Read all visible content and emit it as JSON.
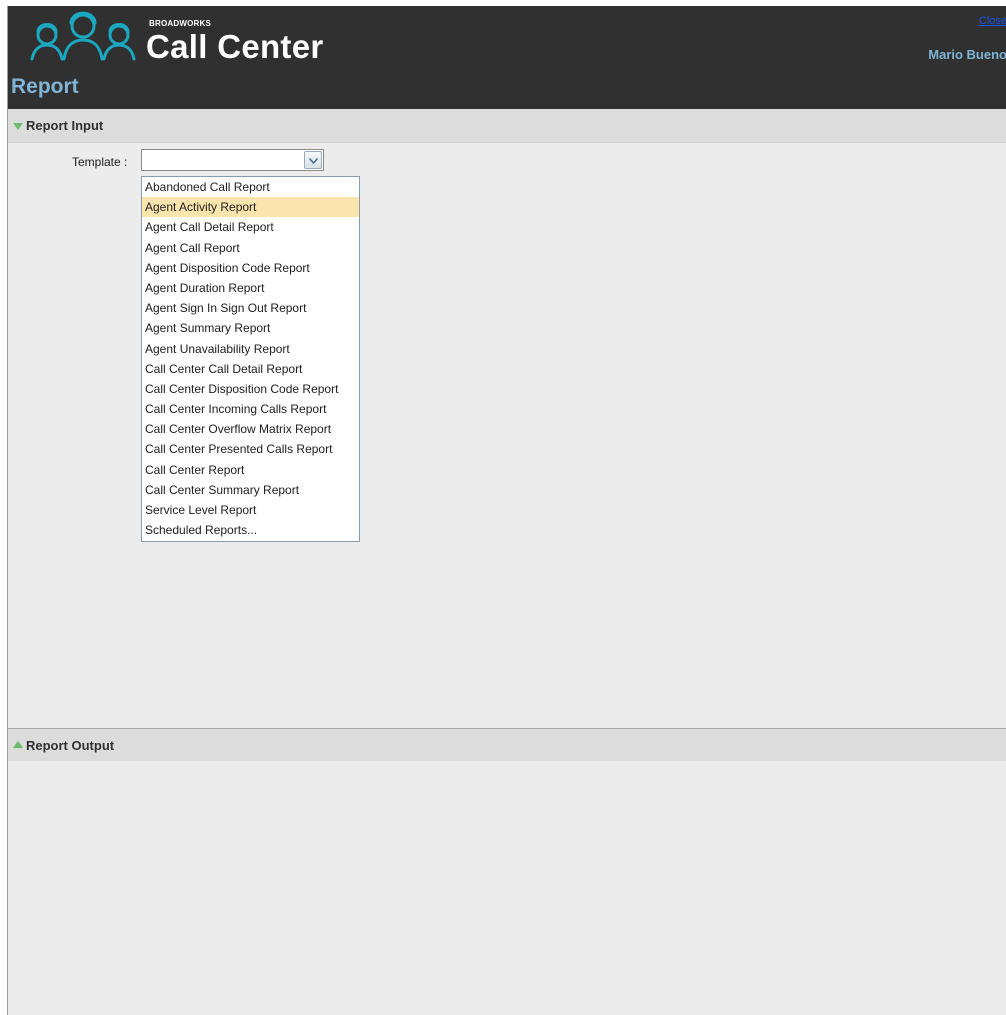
{
  "header": {
    "brand_small": "BROADWORKS",
    "brand_main": "Call Center",
    "page_title": "Report",
    "close_link": "Close",
    "user_name": "Mario Bueno",
    "logo_icon": "agents-headset-icon"
  },
  "sections": {
    "report_input": "Report Input",
    "report_output": "Report Output"
  },
  "form": {
    "template_label": "Template :",
    "template_value": ""
  },
  "template_options": [
    "Abandoned Call Report",
    "Agent Activity Report",
    "Agent Call Detail Report",
    "Agent Call Report",
    "Agent Disposition Code Report",
    "Agent Duration Report",
    "Agent Sign In Sign Out Report",
    "Agent Summary Report",
    "Agent Unavailability Report",
    "Call Center Call Detail Report",
    "Call Center Disposition Code Report",
    "Call Center Incoming Calls Report",
    "Call Center Overflow Matrix Report",
    "Call Center Presented Calls Report",
    "Call Center Report",
    "Call Center Summary Report",
    "Service Level Report",
    "Scheduled Reports..."
  ],
  "hovered_option": "Agent Activity Report",
  "colors": {
    "header_bg": "#303030",
    "accent_blue": "#7fb4d6",
    "logo_teal": "#1aa9c0",
    "triangle_green": "#6dbb6d",
    "hover_highlight": "#fbe5ad",
    "link_blue": "#1a55e8"
  }
}
